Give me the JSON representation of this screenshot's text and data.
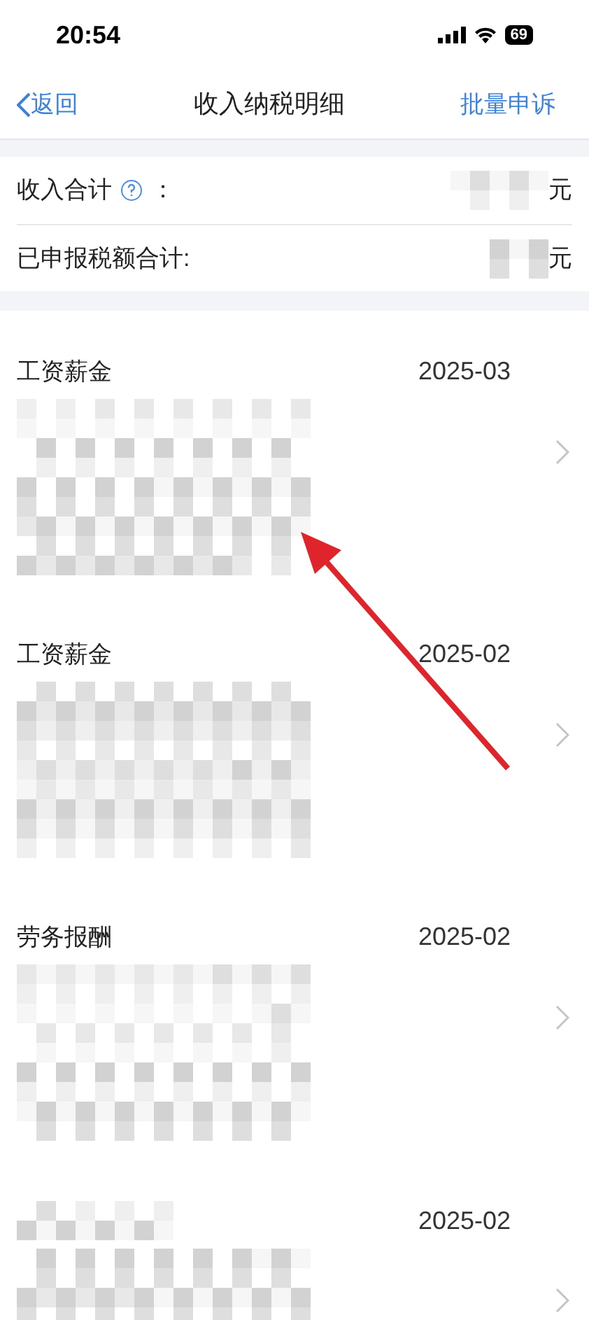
{
  "status_bar": {
    "time": "20:54",
    "battery": "69"
  },
  "nav": {
    "back": "返回",
    "title": "收入纳税明细",
    "action": "批量申诉"
  },
  "summary": [
    {
      "label": "收入合计",
      "help": true,
      "colon": "：",
      "unit": "元"
    },
    {
      "label": "已申报税额合计:",
      "help": false,
      "unit": "元"
    }
  ],
  "records": [
    {
      "category": "工资薪金",
      "date": "2025-03"
    },
    {
      "category": "工资薪金",
      "date": "2025-02"
    },
    {
      "category": "劳务报酬",
      "date": "2025-02"
    },
    {
      "date": "2025-02"
    }
  ]
}
